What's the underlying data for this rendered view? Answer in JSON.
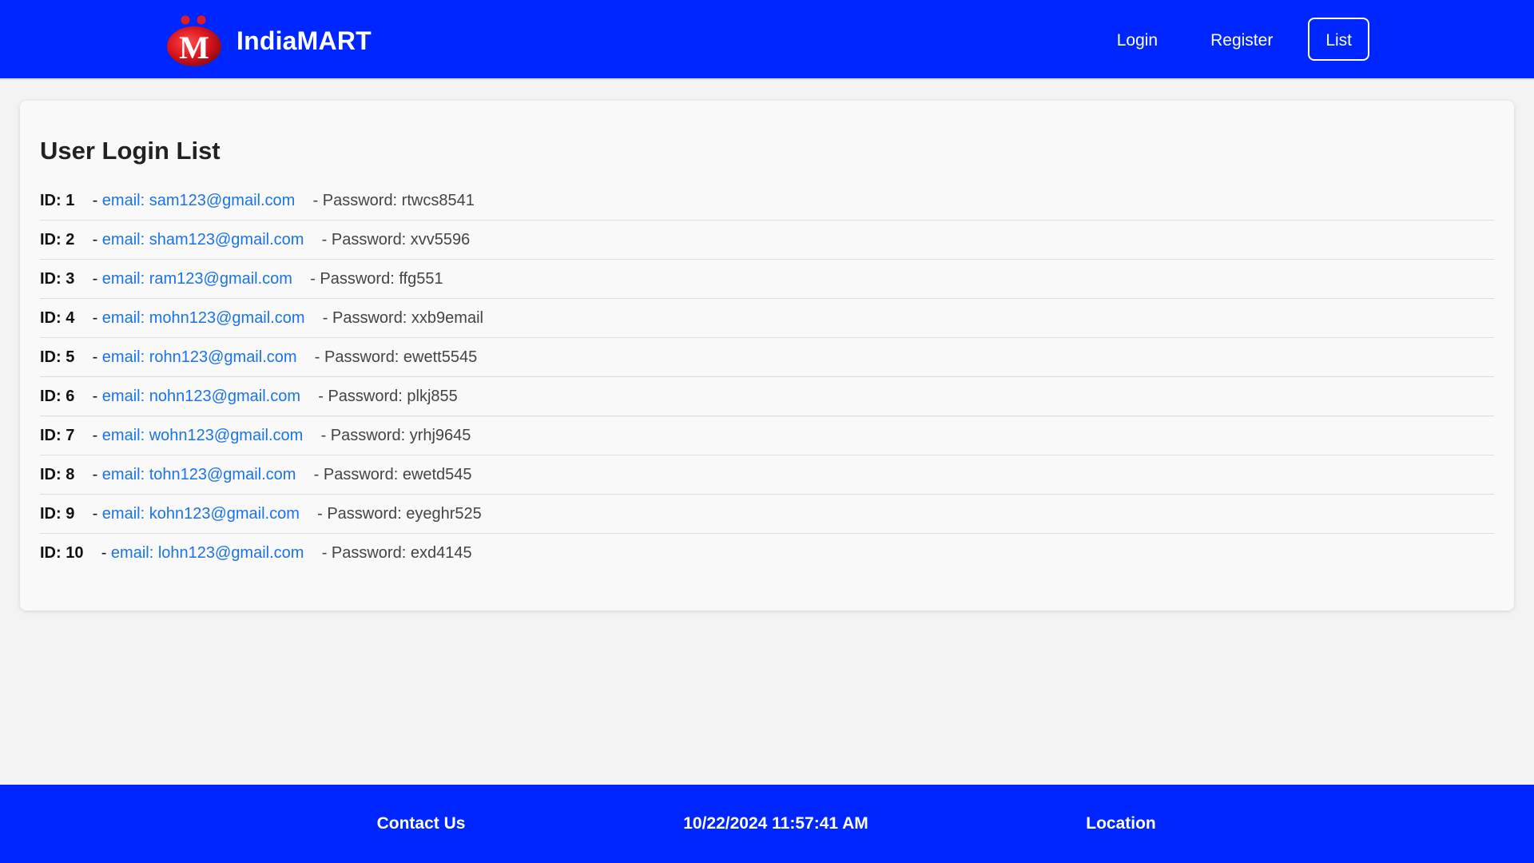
{
  "brand": {
    "name": "IndiaMART",
    "logo_letter": "M",
    "colors": {
      "navbar": "#0026ff",
      "logo_red": "#e31b23",
      "link": "#1a73e8"
    }
  },
  "nav": {
    "items": [
      {
        "label": "Login",
        "active": false
      },
      {
        "label": "Register",
        "active": false
      },
      {
        "label": "List",
        "active": true
      }
    ]
  },
  "main": {
    "title": "User Login List",
    "users": [
      {
        "id": "ID: 1",
        "email": "email: sam123@gmail.com",
        "password": "- Password: rtwcs8541"
      },
      {
        "id": "ID: 2",
        "email": "email: sham123@gmail.com",
        "password": "- Password: xvv5596"
      },
      {
        "id": "ID: 3",
        "email": "email: ram123@gmail.com",
        "password": "- Password: ffg551"
      },
      {
        "id": "ID: 4",
        "email": "email: mohn123@gmail.com",
        "password": "- Password: xxb9email"
      },
      {
        "id": "ID: 5",
        "email": "email: rohn123@gmail.com",
        "password": "- Password: ewett5545"
      },
      {
        "id": "ID: 6",
        "email": "email: nohn123@gmail.com",
        "password": "- Password: plkj855"
      },
      {
        "id": "ID: 7",
        "email": "email: wohn123@gmail.com",
        "password": "- Password: yrhj9645"
      },
      {
        "id": "ID: 8",
        "email": "email: tohn123@gmail.com",
        "password": "- Password: ewetd545"
      },
      {
        "id": "ID: 9",
        "email": "email: kohn123@gmail.com",
        "password": "- Password: eyeghr525"
      },
      {
        "id": "ID: 10",
        "email": "email: lohn123@gmail.com",
        "password": "- Password: exd4145"
      }
    ]
  },
  "footer": {
    "contact": "Contact Us",
    "datetime": "10/22/2024 11:57:41 AM",
    "location": "Location"
  }
}
